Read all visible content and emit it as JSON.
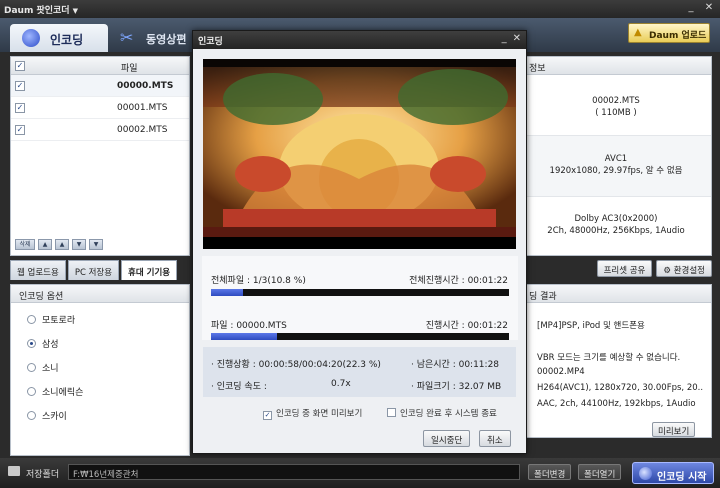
{
  "app": {
    "title": "Daum 팟인코더",
    "title_caret": "▼",
    "window_controls": [
      "_",
      "✕"
    ]
  },
  "header": {
    "tab_encode": "인코딩",
    "tab_edit": "동영상편",
    "upload_button": "Daum 업로드"
  },
  "file_list": {
    "header_checkbox": "✓",
    "column_file": "파일",
    "rows": [
      {
        "checked": "✓",
        "name": "00000.MTS"
      },
      {
        "checked": "✓",
        "name": "00001.MTS"
      },
      {
        "checked": "✓",
        "name": "00002.MTS"
      }
    ],
    "tools": [
      "삭제",
      "▲",
      "▲",
      "▼",
      "▼"
    ]
  },
  "info": {
    "header": "정보",
    "file_name": "00002.MTS",
    "file_size": "( 110MB )",
    "video_codec": "AVC1",
    "video_detail": "1920x1080, 29.97fps, 알 수 없음",
    "audio_codec": "Dolby AC3(0x2000)",
    "audio_detail": "2Ch, 48000Hz, 256Kbps, 1Audio"
  },
  "subtabs": [
    "웹 업로드용",
    "PC 저장용",
    "휴대 기기용"
  ],
  "right_buttons": {
    "preset_share": "프리셋 공유",
    "env_settings": "환경설정"
  },
  "options": {
    "header": "인코딩 옵션",
    "items": [
      "모토로라",
      "삼성",
      "소니",
      "소니에릭슨",
      "스카이"
    ],
    "selected": "삼성"
  },
  "result": {
    "header": "딩 결과",
    "lines": [
      "[MP4]PSP, iPod 및 핸드폰용",
      "VBR 모드는 크기를 예상할 수 없습니다.",
      "00002.MP4",
      "H264(AVC1), 1280x720, 30.00Fps, 20..",
      "AAC, 2ch, 44100Hz, 192kbps, 1Audio"
    ],
    "preview_button": "미리보기"
  },
  "bottom": {
    "save_folder_label": "저장폴더",
    "path": "F:₩16년제중관처",
    "change_folder": "폴더변경",
    "open_folder": "폴더열기",
    "start_button": "인코딩 시작"
  },
  "modal": {
    "title": "인코딩",
    "controls": [
      "_",
      "✕"
    ],
    "total_file_label": "전체파일 : 1/3(10.8 %)",
    "total_time_label": "전체진행시간 :  00:01:22",
    "total_progress": 0.108,
    "file_label": "파일 : 00000.MTS",
    "file_time_label": "진행시간 :  00:01:22",
    "file_progress": 0.223,
    "status_label": "· 진행상황 :  00:00:58/00:04:20(22.3 %)",
    "remaining_label": "· 남은시간 :  00:11:28",
    "speed_label": "· 인코딩 속도 :",
    "speed_value": "0.7x",
    "filesize_label": "· 파일크기 :  32.07 MB",
    "opt_preview": "인코딩 중 화면 미리보기",
    "opt_shutdown": "인코딩 완료 후 시스템 종료",
    "opt_preview_checked": "✓",
    "pause_button": "일시중단",
    "cancel_button": "취소"
  }
}
